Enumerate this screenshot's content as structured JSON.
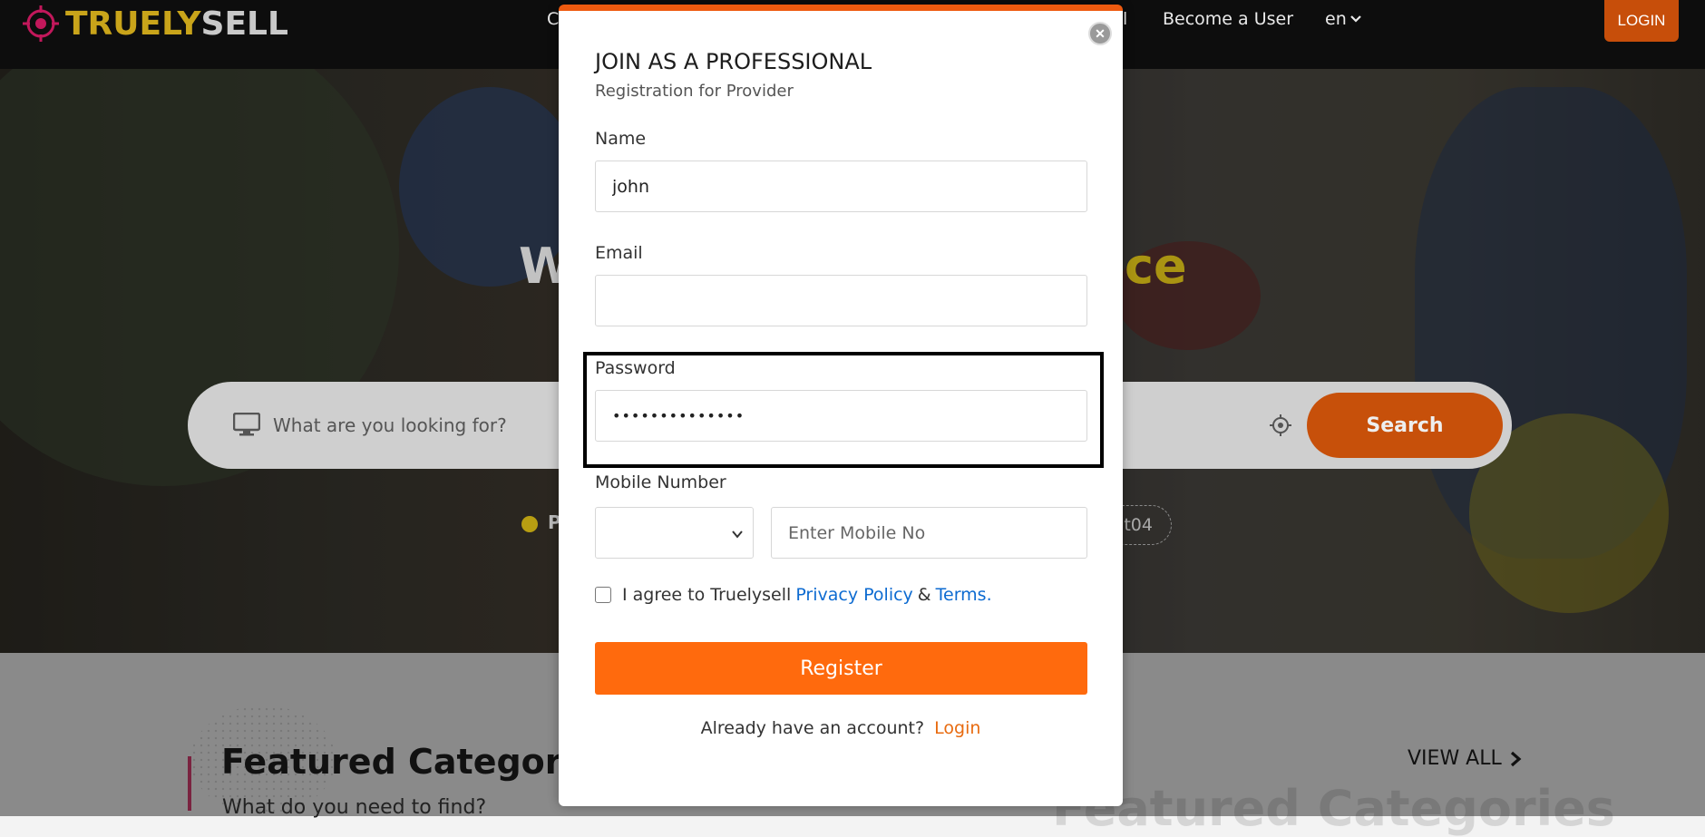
{
  "header": {
    "logo_truely": "TRUELY",
    "logo_sell": "SELL",
    "nav_partial_left": "C",
    "nav_partial_right": "l",
    "become_user": "Become a User",
    "language": "en",
    "login_label": "LOGIN"
  },
  "hero": {
    "title_partial_left": "W",
    "title_partial_right": "ce",
    "search_placeholder": "What are you looking for?",
    "search_button": "Search",
    "popular_partial": "P",
    "tag_partial": "t04"
  },
  "featured": {
    "title": "Featured Categorie",
    "subtitle": "What do you need to find?",
    "view_all": "VIEW ALL",
    "watermark": "Featured Categories"
  },
  "modal": {
    "title": "JOIN AS A PROFESSIONAL",
    "subtitle": "Registration for Provider",
    "name_label": "Name",
    "name_value": "john",
    "email_label": "Email",
    "email_value": "",
    "password_label": "Password",
    "password_value": "••••••••••••••",
    "mobile_label": "Mobile Number",
    "country_value": "",
    "mobile_placeholder": "Enter Mobile No",
    "agree_text": "I agree to Truelysell",
    "privacy_link": "Privacy Policy",
    "amp": "&",
    "terms_link": "Terms.",
    "register_button": "Register",
    "already_text": "Already have an account?",
    "login_link": "Login"
  },
  "colors": {
    "accent": "#ff6a0d",
    "link": "#0d6bd1",
    "header_bg": "#0d0d0d"
  }
}
